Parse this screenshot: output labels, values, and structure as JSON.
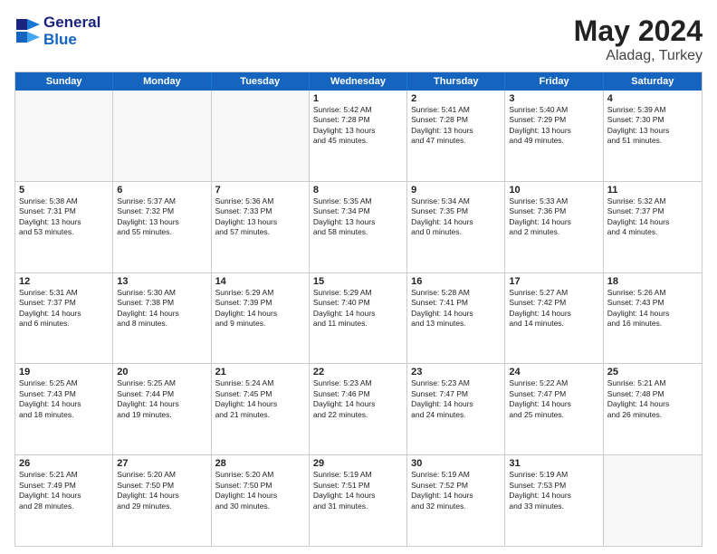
{
  "header": {
    "logo_line1": "General",
    "logo_line2": "Blue",
    "month_year": "May 2024",
    "location": "Aladag, Turkey"
  },
  "days_of_week": [
    "Sunday",
    "Monday",
    "Tuesday",
    "Wednesday",
    "Thursday",
    "Friday",
    "Saturday"
  ],
  "weeks": [
    [
      {
        "day": "",
        "empty": true
      },
      {
        "day": "",
        "empty": true
      },
      {
        "day": "",
        "empty": true
      },
      {
        "day": "1",
        "lines": [
          "Sunrise: 5:42 AM",
          "Sunset: 7:28 PM",
          "Daylight: 13 hours",
          "and 45 minutes."
        ]
      },
      {
        "day": "2",
        "lines": [
          "Sunrise: 5:41 AM",
          "Sunset: 7:28 PM",
          "Daylight: 13 hours",
          "and 47 minutes."
        ]
      },
      {
        "day": "3",
        "lines": [
          "Sunrise: 5:40 AM",
          "Sunset: 7:29 PM",
          "Daylight: 13 hours",
          "and 49 minutes."
        ]
      },
      {
        "day": "4",
        "lines": [
          "Sunrise: 5:39 AM",
          "Sunset: 7:30 PM",
          "Daylight: 13 hours",
          "and 51 minutes."
        ]
      }
    ],
    [
      {
        "day": "5",
        "lines": [
          "Sunrise: 5:38 AM",
          "Sunset: 7:31 PM",
          "Daylight: 13 hours",
          "and 53 minutes."
        ]
      },
      {
        "day": "6",
        "lines": [
          "Sunrise: 5:37 AM",
          "Sunset: 7:32 PM",
          "Daylight: 13 hours",
          "and 55 minutes."
        ]
      },
      {
        "day": "7",
        "lines": [
          "Sunrise: 5:36 AM",
          "Sunset: 7:33 PM",
          "Daylight: 13 hours",
          "and 57 minutes."
        ]
      },
      {
        "day": "8",
        "lines": [
          "Sunrise: 5:35 AM",
          "Sunset: 7:34 PM",
          "Daylight: 13 hours",
          "and 58 minutes."
        ]
      },
      {
        "day": "9",
        "lines": [
          "Sunrise: 5:34 AM",
          "Sunset: 7:35 PM",
          "Daylight: 14 hours",
          "and 0 minutes."
        ]
      },
      {
        "day": "10",
        "lines": [
          "Sunrise: 5:33 AM",
          "Sunset: 7:36 PM",
          "Daylight: 14 hours",
          "and 2 minutes."
        ]
      },
      {
        "day": "11",
        "lines": [
          "Sunrise: 5:32 AM",
          "Sunset: 7:37 PM",
          "Daylight: 14 hours",
          "and 4 minutes."
        ]
      }
    ],
    [
      {
        "day": "12",
        "lines": [
          "Sunrise: 5:31 AM",
          "Sunset: 7:37 PM",
          "Daylight: 14 hours",
          "and 6 minutes."
        ]
      },
      {
        "day": "13",
        "lines": [
          "Sunrise: 5:30 AM",
          "Sunset: 7:38 PM",
          "Daylight: 14 hours",
          "and 8 minutes."
        ]
      },
      {
        "day": "14",
        "lines": [
          "Sunrise: 5:29 AM",
          "Sunset: 7:39 PM",
          "Daylight: 14 hours",
          "and 9 minutes."
        ]
      },
      {
        "day": "15",
        "lines": [
          "Sunrise: 5:29 AM",
          "Sunset: 7:40 PM",
          "Daylight: 14 hours",
          "and 11 minutes."
        ]
      },
      {
        "day": "16",
        "lines": [
          "Sunrise: 5:28 AM",
          "Sunset: 7:41 PM",
          "Daylight: 14 hours",
          "and 13 minutes."
        ]
      },
      {
        "day": "17",
        "lines": [
          "Sunrise: 5:27 AM",
          "Sunset: 7:42 PM",
          "Daylight: 14 hours",
          "and 14 minutes."
        ]
      },
      {
        "day": "18",
        "lines": [
          "Sunrise: 5:26 AM",
          "Sunset: 7:43 PM",
          "Daylight: 14 hours",
          "and 16 minutes."
        ]
      }
    ],
    [
      {
        "day": "19",
        "lines": [
          "Sunrise: 5:25 AM",
          "Sunset: 7:43 PM",
          "Daylight: 14 hours",
          "and 18 minutes."
        ]
      },
      {
        "day": "20",
        "lines": [
          "Sunrise: 5:25 AM",
          "Sunset: 7:44 PM",
          "Daylight: 14 hours",
          "and 19 minutes."
        ]
      },
      {
        "day": "21",
        "lines": [
          "Sunrise: 5:24 AM",
          "Sunset: 7:45 PM",
          "Daylight: 14 hours",
          "and 21 minutes."
        ]
      },
      {
        "day": "22",
        "lines": [
          "Sunrise: 5:23 AM",
          "Sunset: 7:46 PM",
          "Daylight: 14 hours",
          "and 22 minutes."
        ]
      },
      {
        "day": "23",
        "lines": [
          "Sunrise: 5:23 AM",
          "Sunset: 7:47 PM",
          "Daylight: 14 hours",
          "and 24 minutes."
        ]
      },
      {
        "day": "24",
        "lines": [
          "Sunrise: 5:22 AM",
          "Sunset: 7:47 PM",
          "Daylight: 14 hours",
          "and 25 minutes."
        ]
      },
      {
        "day": "25",
        "lines": [
          "Sunrise: 5:21 AM",
          "Sunset: 7:48 PM",
          "Daylight: 14 hours",
          "and 26 minutes."
        ]
      }
    ],
    [
      {
        "day": "26",
        "lines": [
          "Sunrise: 5:21 AM",
          "Sunset: 7:49 PM",
          "Daylight: 14 hours",
          "and 28 minutes."
        ]
      },
      {
        "day": "27",
        "lines": [
          "Sunrise: 5:20 AM",
          "Sunset: 7:50 PM",
          "Daylight: 14 hours",
          "and 29 minutes."
        ]
      },
      {
        "day": "28",
        "lines": [
          "Sunrise: 5:20 AM",
          "Sunset: 7:50 PM",
          "Daylight: 14 hours",
          "and 30 minutes."
        ]
      },
      {
        "day": "29",
        "lines": [
          "Sunrise: 5:19 AM",
          "Sunset: 7:51 PM",
          "Daylight: 14 hours",
          "and 31 minutes."
        ]
      },
      {
        "day": "30",
        "lines": [
          "Sunrise: 5:19 AM",
          "Sunset: 7:52 PM",
          "Daylight: 14 hours",
          "and 32 minutes."
        ]
      },
      {
        "day": "31",
        "lines": [
          "Sunrise: 5:19 AM",
          "Sunset: 7:53 PM",
          "Daylight: 14 hours",
          "and 33 minutes."
        ]
      },
      {
        "day": "",
        "empty": true
      }
    ]
  ]
}
